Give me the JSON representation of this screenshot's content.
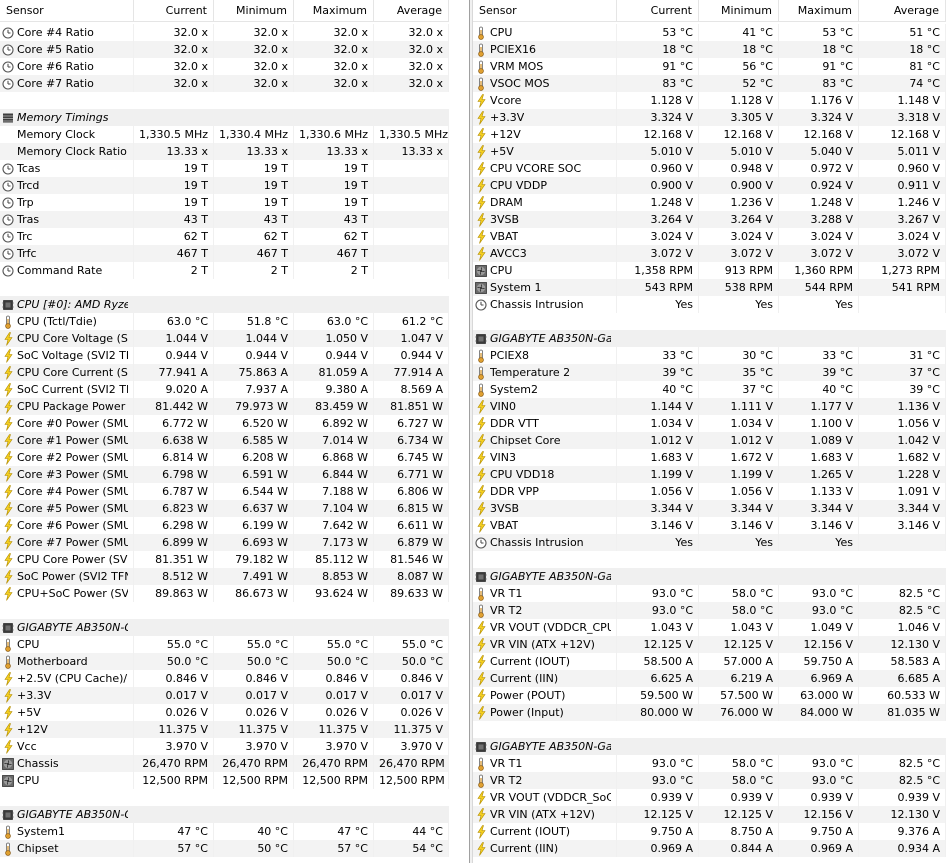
{
  "columns": [
    "Sensor",
    "Current",
    "Minimum",
    "Maximum",
    "Average"
  ],
  "left_rows": [
    {
      "type": "clock",
      "name": "Core #4 Ratio",
      "v": [
        "32.0 x",
        "32.0 x",
        "32.0 x",
        "32.0 x"
      ]
    },
    {
      "type": "clock",
      "name": "Core #5 Ratio",
      "v": [
        "32.0 x",
        "32.0 x",
        "32.0 x",
        "32.0 x"
      ]
    },
    {
      "type": "clock",
      "name": "Core #6 Ratio",
      "v": [
        "32.0 x",
        "32.0 x",
        "32.0 x",
        "32.0 x"
      ]
    },
    {
      "type": "clock",
      "name": "Core #7 Ratio",
      "v": [
        "32.0 x",
        "32.0 x",
        "32.0 x",
        "32.0 x"
      ]
    },
    {
      "type": "empty"
    },
    {
      "type": "group",
      "icon": "memory",
      "name": "Memory Timings"
    },
    {
      "type": "plain",
      "name": "Memory Clock",
      "v": [
        "1,330.5 MHz",
        "1,330.4 MHz",
        "1,330.6 MHz",
        "1,330.5 MHz"
      ]
    },
    {
      "type": "plain",
      "name": "Memory Clock Ratio",
      "v": [
        "13.33 x",
        "13.33 x",
        "13.33 x",
        "13.33 x"
      ]
    },
    {
      "type": "clock",
      "name": "Tcas",
      "v": [
        "19 T",
        "19 T",
        "19 T",
        ""
      ]
    },
    {
      "type": "clock",
      "name": "Trcd",
      "v": [
        "19 T",
        "19 T",
        "19 T",
        ""
      ]
    },
    {
      "type": "clock",
      "name": "Trp",
      "v": [
        "19 T",
        "19 T",
        "19 T",
        ""
      ]
    },
    {
      "type": "clock",
      "name": "Tras",
      "v": [
        "43 T",
        "43 T",
        "43 T",
        ""
      ]
    },
    {
      "type": "clock",
      "name": "Trc",
      "v": [
        "62 T",
        "62 T",
        "62 T",
        ""
      ]
    },
    {
      "type": "clock",
      "name": "Trfc",
      "v": [
        "467 T",
        "467 T",
        "467 T",
        ""
      ]
    },
    {
      "type": "clock",
      "name": "Command Rate",
      "v": [
        "2 T",
        "2 T",
        "2 T",
        ""
      ]
    },
    {
      "type": "empty"
    },
    {
      "type": "group",
      "icon": "chip",
      "name": "CPU [#0]: AMD Ryze..."
    },
    {
      "type": "temp",
      "name": "CPU (Tctl/Tdie)",
      "v": [
        "63.0 °C",
        "51.8 °C",
        "63.0 °C",
        "61.2 °C"
      ]
    },
    {
      "type": "volt",
      "name": "CPU Core Voltage (S...",
      "v": [
        "1.044 V",
        "1.044 V",
        "1.050 V",
        "1.047 V"
      ]
    },
    {
      "type": "volt",
      "name": "SoC Voltage (SVI2 TFN)",
      "v": [
        "0.944 V",
        "0.944 V",
        "0.944 V",
        "0.944 V"
      ]
    },
    {
      "type": "volt",
      "name": "CPU Core Current (S...",
      "v": [
        "77.941 A",
        "75.863 A",
        "81.059 A",
        "77.914 A"
      ]
    },
    {
      "type": "volt",
      "name": "SoC Current (SVI2 TFN)",
      "v": [
        "9.020 A",
        "7.937 A",
        "9.380 A",
        "8.569 A"
      ]
    },
    {
      "type": "volt",
      "name": "CPU Package Power (...",
      "v": [
        "81.442 W",
        "79.973 W",
        "83.459 W",
        "81.851 W"
      ]
    },
    {
      "type": "volt",
      "name": "Core #0 Power (SMU)",
      "v": [
        "6.772 W",
        "6.520 W",
        "6.892 W",
        "6.727 W"
      ]
    },
    {
      "type": "volt",
      "name": "Core #1 Power (SMU)",
      "v": [
        "6.638 W",
        "6.585 W",
        "7.014 W",
        "6.734 W"
      ]
    },
    {
      "type": "volt",
      "name": "Core #2 Power (SMU)",
      "v": [
        "6.814 W",
        "6.208 W",
        "6.868 W",
        "6.745 W"
      ]
    },
    {
      "type": "volt",
      "name": "Core #3 Power (SMU)",
      "v": [
        "6.798 W",
        "6.591 W",
        "6.844 W",
        "6.771 W"
      ]
    },
    {
      "type": "volt",
      "name": "Core #4 Power (SMU)",
      "v": [
        "6.787 W",
        "6.544 W",
        "7.188 W",
        "6.806 W"
      ]
    },
    {
      "type": "volt",
      "name": "Core #5 Power (SMU)",
      "v": [
        "6.823 W",
        "6.637 W",
        "7.104 W",
        "6.815 W"
      ]
    },
    {
      "type": "volt",
      "name": "Core #6 Power (SMU)",
      "v": [
        "6.298 W",
        "6.199 W",
        "7.642 W",
        "6.611 W"
      ]
    },
    {
      "type": "volt",
      "name": "Core #7 Power (SMU)",
      "v": [
        "6.899 W",
        "6.693 W",
        "7.173 W",
        "6.879 W"
      ]
    },
    {
      "type": "volt",
      "name": "CPU Core Power (SVI...",
      "v": [
        "81.351 W",
        "79.182 W",
        "85.112 W",
        "81.546 W"
      ]
    },
    {
      "type": "volt",
      "name": "SoC Power (SVI2 TFN)",
      "v": [
        "8.512 W",
        "7.491 W",
        "8.853 W",
        "8.087 W"
      ]
    },
    {
      "type": "volt",
      "name": "CPU+SoC Power (SVI...",
      "v": [
        "89.863 W",
        "86.673 W",
        "93.624 W",
        "89.633 W"
      ]
    },
    {
      "type": "empty"
    },
    {
      "type": "group",
      "icon": "chip",
      "name": "GIGABYTE AB350N-G..."
    },
    {
      "type": "temp",
      "name": "CPU",
      "v": [
        "55.0 °C",
        "55.0 °C",
        "55.0 °C",
        "55.0 °C"
      ]
    },
    {
      "type": "temp",
      "name": "Motherboard",
      "v": [
        "50.0 °C",
        "50.0 °C",
        "50.0 °C",
        "50.0 °C"
      ]
    },
    {
      "type": "volt",
      "name": "+2.5V (CPU Cache)/...",
      "v": [
        "0.846 V",
        "0.846 V",
        "0.846 V",
        "0.846 V"
      ]
    },
    {
      "type": "volt",
      "name": "+3.3V",
      "v": [
        "0.017 V",
        "0.017 V",
        "0.017 V",
        "0.017 V"
      ]
    },
    {
      "type": "volt",
      "name": "+5V",
      "v": [
        "0.026 V",
        "0.026 V",
        "0.026 V",
        "0.026 V"
      ]
    },
    {
      "type": "volt",
      "name": "+12V",
      "v": [
        "11.375 V",
        "11.375 V",
        "11.375 V",
        "11.375 V"
      ]
    },
    {
      "type": "volt",
      "name": "Vcc",
      "v": [
        "3.970 V",
        "3.970 V",
        "3.970 V",
        "3.970 V"
      ]
    },
    {
      "type": "fan",
      "name": "Chassis",
      "v": [
        "26,470 RPM",
        "26,470 RPM",
        "26,470 RPM",
        "26,470 RPM"
      ]
    },
    {
      "type": "fan",
      "name": "CPU",
      "v": [
        "12,500 RPM",
        "12,500 RPM",
        "12,500 RPM",
        "12,500 RPM"
      ]
    },
    {
      "type": "empty"
    },
    {
      "type": "group",
      "icon": "chip",
      "name": "GIGABYTE AB350N-G..."
    },
    {
      "type": "temp",
      "name": "System1",
      "v": [
        "47 °C",
        "40 °C",
        "47 °C",
        "44 °C"
      ]
    },
    {
      "type": "temp",
      "name": "Chipset",
      "v": [
        "57 °C",
        "50 °C",
        "57 °C",
        "54 °C"
      ]
    }
  ],
  "right_rows": [
    {
      "type": "temp",
      "name": "CPU",
      "v": [
        "53 °C",
        "41 °C",
        "53 °C",
        "51 °C"
      ]
    },
    {
      "type": "temp",
      "name": "PCIEX16",
      "v": [
        "18 °C",
        "18 °C",
        "18 °C",
        "18 °C"
      ]
    },
    {
      "type": "temp",
      "name": "VRM MOS",
      "v": [
        "91 °C",
        "56 °C",
        "91 °C",
        "81 °C"
      ]
    },
    {
      "type": "temp",
      "name": "VSOC MOS",
      "v": [
        "83 °C",
        "52 °C",
        "83 °C",
        "74 °C"
      ]
    },
    {
      "type": "volt",
      "name": "Vcore",
      "v": [
        "1.128 V",
        "1.128 V",
        "1.176 V",
        "1.148 V"
      ]
    },
    {
      "type": "volt",
      "name": "+3.3V",
      "v": [
        "3.324 V",
        "3.305 V",
        "3.324 V",
        "3.318 V"
      ]
    },
    {
      "type": "volt",
      "name": "+12V",
      "v": [
        "12.168 V",
        "12.168 V",
        "12.168 V",
        "12.168 V"
      ]
    },
    {
      "type": "volt",
      "name": "+5V",
      "v": [
        "5.010 V",
        "5.010 V",
        "5.040 V",
        "5.011 V"
      ]
    },
    {
      "type": "volt",
      "name": "CPU VCORE SOC",
      "v": [
        "0.960 V",
        "0.948 V",
        "0.972 V",
        "0.960 V"
      ]
    },
    {
      "type": "volt",
      "name": "CPU VDDP",
      "v": [
        "0.900 V",
        "0.900 V",
        "0.924 V",
        "0.911 V"
      ]
    },
    {
      "type": "volt",
      "name": "DRAM",
      "v": [
        "1.248 V",
        "1.236 V",
        "1.248 V",
        "1.246 V"
      ]
    },
    {
      "type": "volt",
      "name": "3VSB",
      "v": [
        "3.264 V",
        "3.264 V",
        "3.288 V",
        "3.267 V"
      ]
    },
    {
      "type": "volt",
      "name": "VBAT",
      "v": [
        "3.024 V",
        "3.024 V",
        "3.024 V",
        "3.024 V"
      ]
    },
    {
      "type": "volt",
      "name": "AVCC3",
      "v": [
        "3.072 V",
        "3.072 V",
        "3.072 V",
        "3.072 V"
      ]
    },
    {
      "type": "fan",
      "name": "CPU",
      "v": [
        "1,358 RPM",
        "913 RPM",
        "1,360 RPM",
        "1,273 RPM"
      ]
    },
    {
      "type": "fan",
      "name": "System 1",
      "v": [
        "543 RPM",
        "538 RPM",
        "544 RPM",
        "541 RPM"
      ]
    },
    {
      "type": "clock",
      "name": "Chassis Intrusion",
      "v": [
        "Yes",
        "Yes",
        "Yes",
        ""
      ]
    },
    {
      "type": "empty"
    },
    {
      "type": "group",
      "icon": "chip",
      "name": "GIGABYTE AB350N-Ga..."
    },
    {
      "type": "temp",
      "name": "PCIEX8",
      "v": [
        "33 °C",
        "30 °C",
        "33 °C",
        "31 °C"
      ]
    },
    {
      "type": "temp",
      "name": "Temperature 2",
      "v": [
        "39 °C",
        "35 °C",
        "39 °C",
        "37 °C"
      ]
    },
    {
      "type": "temp",
      "name": "System2",
      "v": [
        "40 °C",
        "37 °C",
        "40 °C",
        "39 °C"
      ]
    },
    {
      "type": "volt",
      "name": "VIN0",
      "v": [
        "1.144 V",
        "1.111 V",
        "1.177 V",
        "1.136 V"
      ]
    },
    {
      "type": "volt",
      "name": "DDR VTT",
      "v": [
        "1.034 V",
        "1.034 V",
        "1.100 V",
        "1.056 V"
      ]
    },
    {
      "type": "volt",
      "name": "Chipset Core",
      "v": [
        "1.012 V",
        "1.012 V",
        "1.089 V",
        "1.042 V"
      ]
    },
    {
      "type": "volt",
      "name": "VIN3",
      "v": [
        "1.683 V",
        "1.672 V",
        "1.683 V",
        "1.682 V"
      ]
    },
    {
      "type": "volt",
      "name": "CPU VDD18",
      "v": [
        "1.199 V",
        "1.199 V",
        "1.265 V",
        "1.228 V"
      ]
    },
    {
      "type": "volt",
      "name": "DDR VPP",
      "v": [
        "1.056 V",
        "1.056 V",
        "1.133 V",
        "1.091 V"
      ]
    },
    {
      "type": "volt",
      "name": "3VSB",
      "v": [
        "3.344 V",
        "3.344 V",
        "3.344 V",
        "3.344 V"
      ]
    },
    {
      "type": "volt",
      "name": "VBAT",
      "v": [
        "3.146 V",
        "3.146 V",
        "3.146 V",
        "3.146 V"
      ]
    },
    {
      "type": "clock",
      "name": "Chassis Intrusion",
      "v": [
        "Yes",
        "Yes",
        "Yes",
        ""
      ]
    },
    {
      "type": "empty"
    },
    {
      "type": "group",
      "icon": "chip",
      "name": "GIGABYTE AB350N-Ga..."
    },
    {
      "type": "temp",
      "name": "VR T1",
      "v": [
        "93.0 °C",
        "58.0 °C",
        "93.0 °C",
        "82.5 °C"
      ]
    },
    {
      "type": "temp",
      "name": "VR T2",
      "v": [
        "93.0 °C",
        "58.0 °C",
        "93.0 °C",
        "82.5 °C"
      ]
    },
    {
      "type": "volt",
      "name": "VR VOUT (VDDCR_CPU)",
      "v": [
        "1.043 V",
        "1.043 V",
        "1.049 V",
        "1.046 V"
      ]
    },
    {
      "type": "volt",
      "name": "VR VIN (ATX +12V)",
      "v": [
        "12.125 V",
        "12.125 V",
        "12.156 V",
        "12.130 V"
      ]
    },
    {
      "type": "volt",
      "name": "Current (IOUT)",
      "v": [
        "58.500 A",
        "57.000 A",
        "59.750 A",
        "58.583 A"
      ]
    },
    {
      "type": "volt",
      "name": "Current (IIN)",
      "v": [
        "6.625 A",
        "6.219 A",
        "6.969 A",
        "6.685 A"
      ]
    },
    {
      "type": "volt",
      "name": "Power (POUT)",
      "v": [
        "59.500 W",
        "57.500 W",
        "63.000 W",
        "60.533 W"
      ]
    },
    {
      "type": "volt",
      "name": "Power (Input)",
      "v": [
        "80.000 W",
        "76.000 W",
        "84.000 W",
        "81.035 W"
      ]
    },
    {
      "type": "empty"
    },
    {
      "type": "group",
      "icon": "chip",
      "name": "GIGABYTE AB350N-Ga..."
    },
    {
      "type": "temp",
      "name": "VR T1",
      "v": [
        "93.0 °C",
        "58.0 °C",
        "93.0 °C",
        "82.5 °C"
      ]
    },
    {
      "type": "temp",
      "name": "VR T2",
      "v": [
        "93.0 °C",
        "58.0 °C",
        "93.0 °C",
        "82.5 °C"
      ]
    },
    {
      "type": "volt",
      "name": "VR VOUT (VDDCR_SoC)",
      "v": [
        "0.939 V",
        "0.939 V",
        "0.939 V",
        "0.939 V"
      ]
    },
    {
      "type": "volt",
      "name": "VR VIN (ATX +12V)",
      "v": [
        "12.125 V",
        "12.125 V",
        "12.156 V",
        "12.130 V"
      ]
    },
    {
      "type": "volt",
      "name": "Current (IOUT)",
      "v": [
        "9.750 A",
        "8.750 A",
        "9.750 A",
        "9.376 A"
      ]
    },
    {
      "type": "volt",
      "name": "Current (IIN)",
      "v": [
        "0.969 A",
        "0.844 A",
        "0.969 A",
        "0.934 A"
      ]
    }
  ]
}
